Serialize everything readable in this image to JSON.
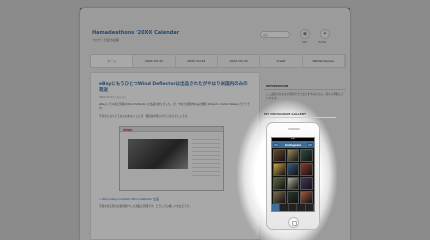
{
  "site": {
    "title": "Hamadeathons '20XX Calendar",
    "subtitle": "ブログ / 日記の記録",
    "search_placeholder": "検索"
  },
  "header_links": [
    {
      "icon": "rss-icon",
      "glyph": "◉",
      "label": "RSS"
    },
    {
      "icon": "twitter-icon",
      "glyph": "✦",
      "label": "Twitter"
    }
  ],
  "nav": [
    {
      "label": "ホーム",
      "active": true
    },
    {
      "label": "20XX Vol.41",
      "active": false
    },
    {
      "label": "20XX Vol.42",
      "active": false
    },
    {
      "label": "20XX Vol.43",
      "active": false
    },
    {
      "label": "Credit",
      "active": false
    },
    {
      "label": "WP/Wordpress",
      "active": false
    }
  ],
  "post": {
    "title": "eBayにもうひとつWind Deflectorは出品されたがやはり米国内のみの発送",
    "meta": "20XX.XX.XX / カテゴリ",
    "text": "eBay にて以前と同様のWind Deflector の出品がありました。が、やはり米国内のみの発送 (Ships to United States) だそうです。",
    "text2": "不具合になりそうなものをなくしたが、発送先が限られているのでしょうか。",
    "image_logo": "ebay",
    "link": "» http://ebay.com/item Wind Deflector 出品",
    "text3": "写真を見る限りは前回紹介した商品と同様です。どうしても欲しい方はどうぞ。"
  },
  "sidebar": {
    "info_heading": "INFORMATION",
    "info_text": "ここ最近はなかなか更新できておらずすみません。徐々に再開していきます。",
    "gallery_heading": "MY INSTAGRAM GALLERY"
  },
  "phone_app": {
    "status": "9:41",
    "title": "Instagram",
    "tiles": [
      "#6b4a2e",
      "#9b8a5c",
      "#2f4f3f",
      "#c8a24a",
      "#3a5a7a",
      "#8a3a2a",
      "#5a6a3a",
      "#b0b0a0",
      "#4a3a5a",
      "#7a6a4a",
      "#2a3a2a",
      "#a05a3a"
    ]
  }
}
